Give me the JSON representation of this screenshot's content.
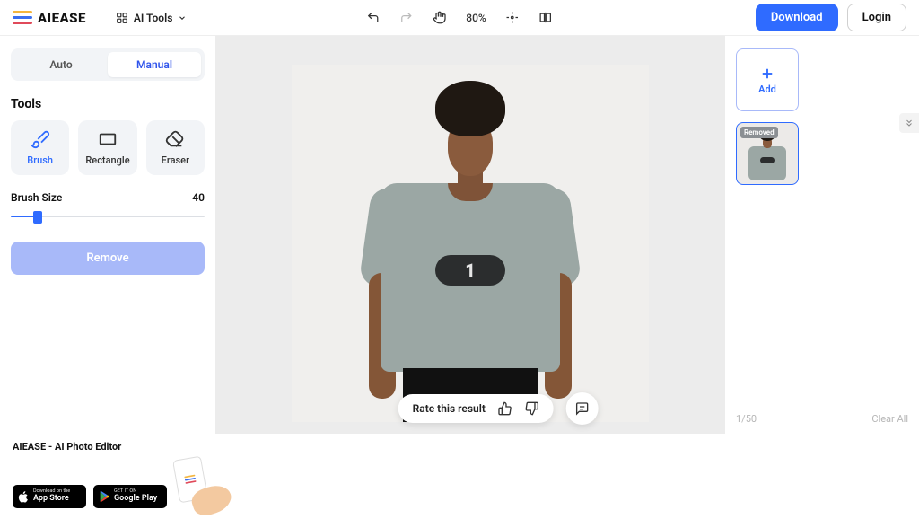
{
  "header": {
    "brand": "AIEASE",
    "ai_tools_label": "AI Tools",
    "zoom": "80%",
    "download": "Download",
    "login": "Login"
  },
  "sidebar": {
    "mode_auto": "Auto",
    "mode_manual": "Manual",
    "tools_label": "Tools",
    "tool_brush": "Brush",
    "tool_rectangle": "Rectangle",
    "tool_eraser": "Eraser",
    "brush_size_label": "Brush Size",
    "brush_size_value": "40",
    "remove_btn": "Remove"
  },
  "canvas": {
    "shirt_number": "1",
    "rate_label": "Rate this result"
  },
  "right": {
    "add_label": "Add",
    "thumb_badge": "Removed",
    "counter": "1/50",
    "clear_all": "Clear All"
  },
  "bottom": {
    "title": "AIEASE - AI Photo Editor",
    "appstore_small": "Download on the",
    "appstore_big": "App Store",
    "play_small": "GET IT ON",
    "play_big": "Google Play"
  }
}
